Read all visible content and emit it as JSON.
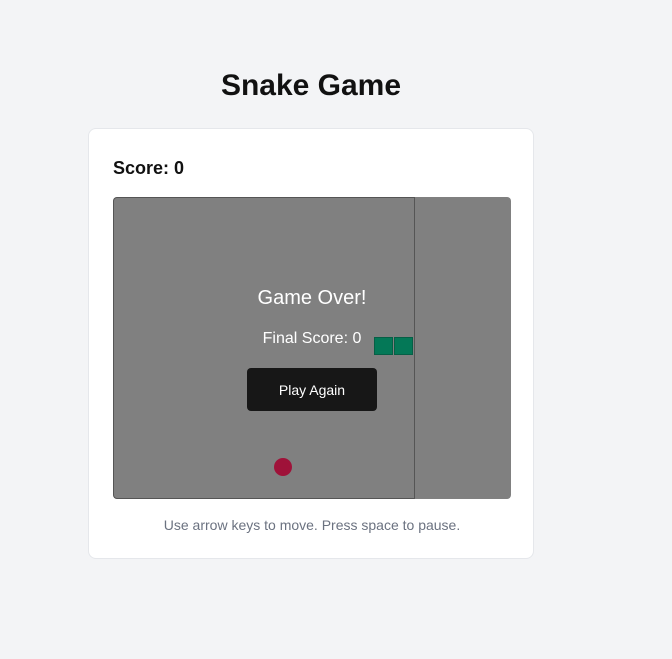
{
  "header": {
    "title": "Snake Game"
  },
  "game": {
    "score_text": "Score: 0",
    "overlay_title": "Game Over!",
    "final_score_text": "Final Score: 0",
    "play_again_label": "Play Again",
    "instructions": "Use arrow keys to move. Press space to pause."
  },
  "colors": {
    "board": "#808080",
    "snake": "#047857",
    "food": "#9f1239",
    "button": "#171717"
  },
  "icons": {
    "food": "food-dot-icon",
    "snake": "snake-segment"
  }
}
